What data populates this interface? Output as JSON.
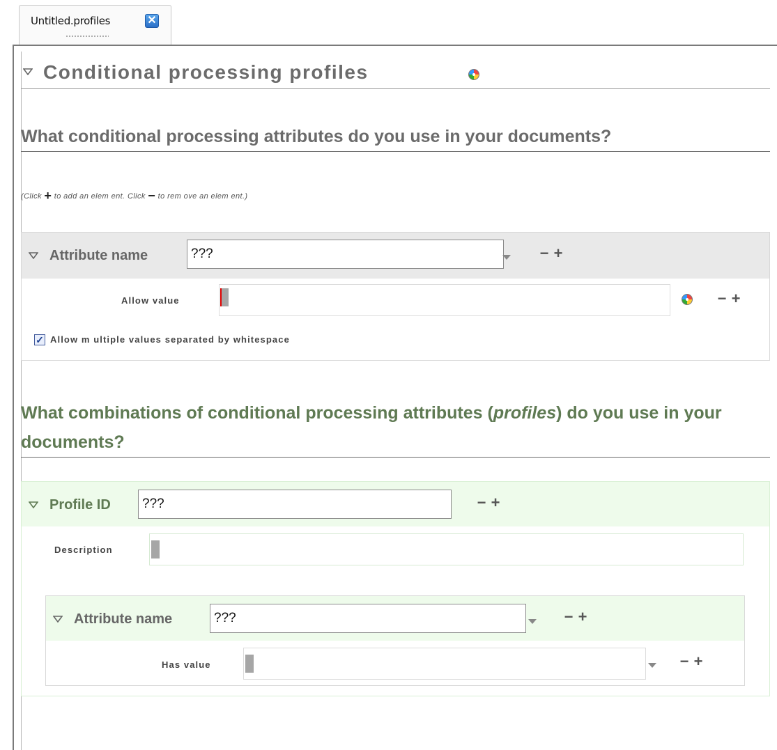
{
  "tab": {
    "title": "Untitled.profiles",
    "close_glyph": "✕"
  },
  "main_heading": {
    "title": "Conditional processing profiles"
  },
  "section1": {
    "heading": "What conditional processing attributes do you use in your documents?",
    "hint_prefix": "(Click ",
    "hint_add_glyph": "+",
    "hint_middle": " to add an elem ent. Click ",
    "hint_remove_glyph": "−",
    "hint_suffix": " to rem ove an elem ent.)",
    "attribute": {
      "label": "Attribute name",
      "value": "???",
      "allow_value_label": "Allow value",
      "allow_value": "",
      "multi_checkbox_label": "Allow m ultiple values separated by whitespace",
      "multi_checked": true
    }
  },
  "section2": {
    "heading_part1": "What combinations of conditional processing attributes (",
    "heading_em": "profiles",
    "heading_part2": ") do you use in your documents?",
    "profile": {
      "label": "Profile ID",
      "value": "???",
      "description_label": "Description",
      "description_value": "",
      "attribute": {
        "label": "Attribute name",
        "value": "???",
        "has_value_label": "Has value",
        "has_value": ""
      }
    }
  },
  "controls": {
    "remove": "−",
    "add": "+",
    "check": "✓"
  },
  "icons": {
    "palette": "palette-icon",
    "collapse": "triangle-down-icon",
    "dropdown": "caret-down-icon"
  },
  "colors": {
    "heading_gray": "#6b6b6b",
    "heading_green": "#5f7a53",
    "profile_bg": "#eefbeb",
    "block_head_bg": "#e9e9e9"
  }
}
